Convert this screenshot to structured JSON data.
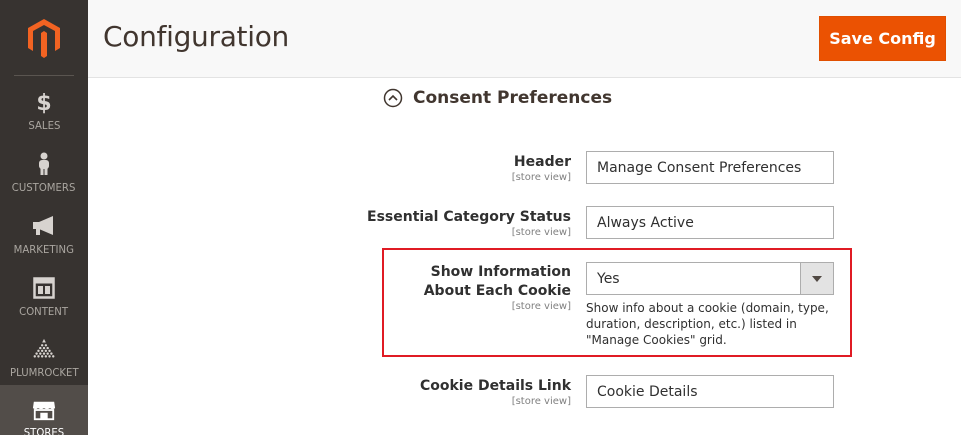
{
  "sidebar": {
    "logo": "magento-logo-icon",
    "items": [
      {
        "label": "SALES",
        "icon": "dollar-icon"
      },
      {
        "label": "CUSTOMERS",
        "icon": "person-icon"
      },
      {
        "label": "MARKETING",
        "icon": "megaphone-icon"
      },
      {
        "label": "CONTENT",
        "icon": "layout-icon"
      },
      {
        "label": "PLUMROCKET",
        "icon": "plumrocket-icon"
      },
      {
        "label": "STORES",
        "icon": "store-icon",
        "active": true
      }
    ]
  },
  "header": {
    "title": "Configuration",
    "save_label": "Save Config"
  },
  "section": {
    "title": "Consent Preferences",
    "expanded": true
  },
  "fields": {
    "header": {
      "label": "Header",
      "scope": "[store view]",
      "value": "Manage Consent Preferences"
    },
    "essential_status": {
      "label": "Essential Category Status",
      "scope": "[store view]",
      "value": "Always Active"
    },
    "show_info": {
      "label": "Show Information About Each Cookie",
      "scope": "[store view]",
      "value": "Yes",
      "note": "Show info about a cookie (domain, type, duration, description, etc.) listed in \"Manage Cookies\" grid."
    },
    "details_link": {
      "label": "Cookie Details Link",
      "scope": "[store view]",
      "value": "Cookie Details"
    }
  },
  "colors": {
    "accent": "#eb5202",
    "sidebar_bg": "#373330",
    "highlight": "#e01b24"
  }
}
